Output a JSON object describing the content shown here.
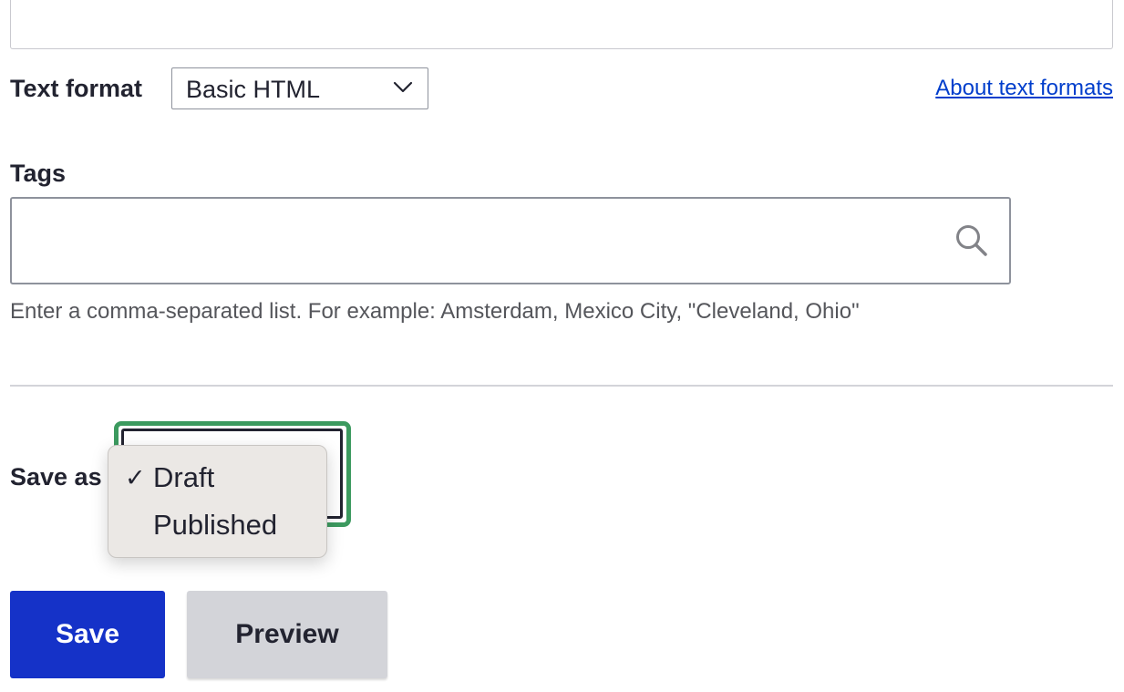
{
  "text_format": {
    "label": "Text format",
    "selected": "Basic HTML",
    "chevron_icon": "chevron-down-icon",
    "help_link": "About text formats"
  },
  "tags": {
    "label": "Tags",
    "value": "",
    "search_icon": "search-icon",
    "help": "Enter a comma-separated list. For example: Amsterdam, Mexico City, \"Cleveland, Ohio\""
  },
  "save_as": {
    "label": "Save as",
    "options": [
      {
        "label": "Draft",
        "checked": true,
        "check_glyph": "✓"
      },
      {
        "label": "Published",
        "checked": false,
        "check_glyph": ""
      }
    ],
    "focus_color": "#3c9a5f"
  },
  "actions": {
    "save_label": "Save",
    "preview_label": "Preview",
    "save_color": "#1532c8",
    "preview_color": "#d3d4d9"
  },
  "colors": {
    "link": "#003ecc",
    "text": "#222330",
    "help_text": "#55565b"
  }
}
